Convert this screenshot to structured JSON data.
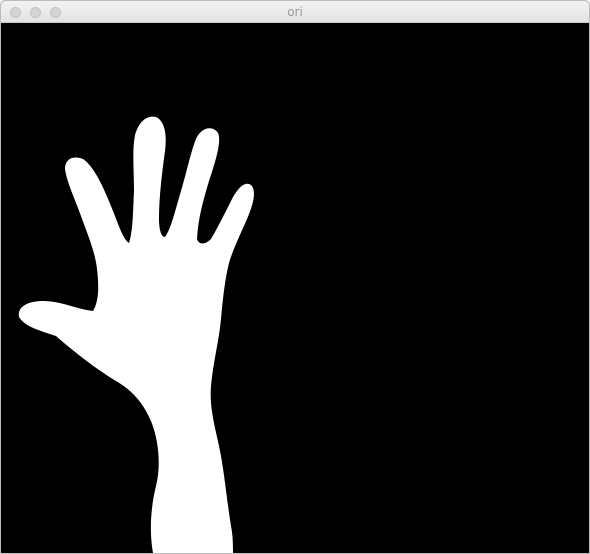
{
  "window": {
    "title": "ori",
    "controls": [
      "close-icon",
      "minimize-icon",
      "zoom-icon"
    ]
  },
  "image": {
    "description_icon": "hand-mask",
    "background_color": "#000000",
    "foreground_color": "#ffffff"
  }
}
